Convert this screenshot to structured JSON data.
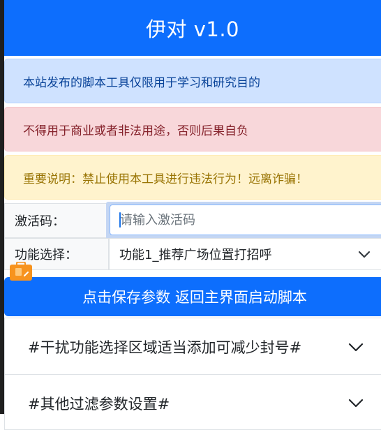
{
  "header": {
    "title": "伊对 v1.0"
  },
  "alerts": [
    {
      "text": "本站发布的脚本工具仅限用于学习和研究目的",
      "type": "info"
    },
    {
      "text": "不得用于商业或者非法用途，否则后果自负",
      "type": "danger"
    },
    {
      "text": "重要说明：禁止使用本工具进行违法行为！远离诈骗！",
      "type": "warning"
    }
  ],
  "form": {
    "activation_label": "激活码：",
    "activation_placeholder": "请输入激活码",
    "activation_value": "",
    "function_label": "功能选择：",
    "function_selected": "功能1_推荐广场位置打招呼"
  },
  "actions": {
    "save_button": "点击保存参数 返回主界面启动脚本"
  },
  "accordion": [
    {
      "title": "#干扰功能选择区域适当添加可减少封号#"
    },
    {
      "title": "#其他过滤参数设置#"
    }
  ],
  "colors": {
    "primary": "#0d6efd",
    "info_bg": "#cfe2ff",
    "danger_bg": "#f8d7da",
    "warning_bg": "#fff3cd",
    "floating_icon": "#f7931e"
  },
  "icons": {
    "select": "chevron-down-icon",
    "floating": "floating-toolbox-icon",
    "accordion": "chevron-down-icon"
  }
}
